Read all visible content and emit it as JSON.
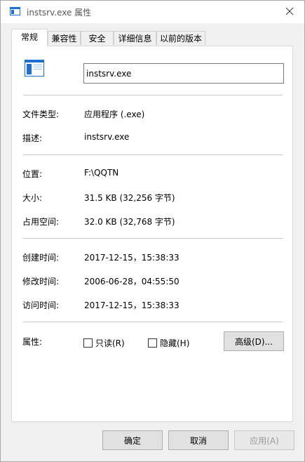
{
  "window": {
    "title": "instsrv.exe 属性"
  },
  "tabs": [
    {
      "label": "常规",
      "active": true
    },
    {
      "label": "兼容性"
    },
    {
      "label": "安全"
    },
    {
      "label": "详细信息"
    },
    {
      "label": "以前的版本"
    }
  ],
  "general": {
    "file_name": "instsrv.exe",
    "type_label": "文件类型:",
    "type_value": "应用程序 (.exe)",
    "desc_label": "描述:",
    "desc_value": "instsrv.exe",
    "location_label": "位置:",
    "location_value": "F:\\QQTN",
    "size_label": "大小:",
    "size_value": "31.5 KB (32,256 字节)",
    "disk_label": "占用空间:",
    "disk_value": "32.0 KB (32,768 字节)",
    "created_label": "创建时间:",
    "created_value": "2017-12-15，15:38:33",
    "modified_label": "修改时间:",
    "modified_value": "2006-06-28，04:55:50",
    "accessed_label": "访问时间:",
    "accessed_value": "2017-12-15，15:38:33",
    "attributes_label": "属性:",
    "readonly_label": "只读(R)",
    "readonly_checked": false,
    "hidden_label": "隐藏(H)",
    "hidden_checked": false,
    "advanced_label": "高级(D)..."
  },
  "footer": {
    "ok_label": "确定",
    "cancel_label": "取消",
    "apply_label": "应用(A)"
  },
  "icons": {
    "app": "window-app-icon",
    "close": "close-icon",
    "file": "executable-file-icon"
  },
  "colors": {
    "window_bg": "#f0f0f0",
    "panel_bg": "#ffffff",
    "icon_blue": "#1f6fd0",
    "button_bg": "#e1e1e1",
    "disabled_text": "#9b9b9b"
  }
}
